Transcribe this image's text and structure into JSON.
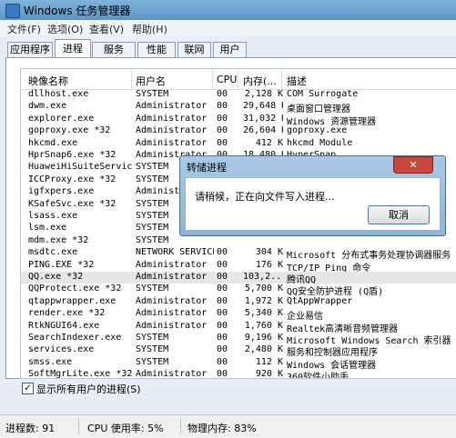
{
  "window": {
    "title": "Windows 任务管理器"
  },
  "menu": [
    "文件(F)",
    "选项(O)",
    "查看(V)",
    "帮助(H)"
  ],
  "tabs": [
    "应用程序",
    "进程",
    "服务",
    "性能",
    "联网",
    "用户"
  ],
  "active_tab": "进程",
  "columns": [
    "映像名称",
    "用户名",
    "CPU",
    "内存(...",
    "描述"
  ],
  "rows": [
    [
      "dllhost.exe",
      "SYSTEM",
      "00",
      "2,128 K",
      "COM Surrogate"
    ],
    [
      "dwm.exe",
      "Administrator",
      "00",
      "29,648 K",
      "桌面窗口管理器"
    ],
    [
      "explorer.exe",
      "Administrator",
      "00",
      "31,032 K",
      "Windows 资源管理器"
    ],
    [
      "goproxy.exe *32",
      "Administrator",
      "00",
      "26,604 K",
      "goproxy.exe"
    ],
    [
      "hkcmd.exe",
      "Administrator",
      "00",
      "412 K",
      "hkcmd Module"
    ],
    [
      "HprSnap6.exe *32",
      "Administrator",
      "00",
      "18,480 K",
      "HyperSnap"
    ],
    [
      "HuaweiHiSuiteServic...",
      "SYSTEM",
      "",
      "",
      ""
    ],
    [
      "ICCProxy.exe *32",
      "SYSTEM",
      "",
      "",
      ""
    ],
    [
      "igfxpers.exe",
      "Administr",
      "",
      "",
      ""
    ],
    [
      "KSafeSvc.exe *32",
      "SYSTEM",
      "",
      "",
      ""
    ],
    [
      "lsass.exe",
      "SYSTEM",
      "",
      "",
      ""
    ],
    [
      "lsm.exe",
      "SYSTEM",
      "",
      "",
      ""
    ],
    [
      "mdm.exe *32",
      "SYSTEM",
      "",
      "",
      ""
    ],
    [
      "msdtc.exe",
      "NETWORK SERVICE",
      "00",
      "304 K",
      "Microsoft 分布式事务处理协调器服务"
    ],
    [
      "PING.EXE *32",
      "Administrator",
      "00",
      "176 K",
      "TCP/IP Ping 命令"
    ],
    [
      "QQ.exe *32",
      "Administrator",
      "00",
      "103,2...",
      "腾讯QQ"
    ],
    [
      "QQProtect.exe *32",
      "SYSTEM",
      "00",
      "5,700 K",
      "QQ安全防护进程 (Q盾)"
    ],
    [
      "qtappwrapper.exe",
      "Administrator",
      "00",
      "1,972 K",
      "QtAppWrapper"
    ],
    [
      "render.exe *32",
      "Administrator",
      "00",
      "5,340 K",
      "企业易信"
    ],
    [
      "RtkNGUI64.exe",
      "Administrator",
      "00",
      "1,760 K",
      "Realtek高清晰音频管理器"
    ],
    [
      "SearchIndexer.exe",
      "SYSTEM",
      "00",
      "9,196 K",
      "Microsoft Windows Search 索引器"
    ],
    [
      "services.exe",
      "SYSTEM",
      "00",
      "2,480 K",
      "服务和控制器应用程序"
    ],
    [
      "smss.exe",
      "SYSTEM",
      "00",
      "112 K",
      "Windows 会话管理器"
    ],
    [
      "SoftMgrLite.exe *32",
      "Administrator",
      "00",
      "920 K",
      "360软件小助手"
    ]
  ],
  "selected_row_index": 15,
  "show_all_users": {
    "label": "显示所有用户的进程(S)",
    "checked": true
  },
  "status": {
    "processes": "进程数: 91",
    "cpu": "CPU 使用率: 5%",
    "memory": "物理内存: 83%"
  },
  "dialog": {
    "title": "转储进程",
    "message": "请稍候，正在向文件写入进程...",
    "cancel": "取消"
  }
}
